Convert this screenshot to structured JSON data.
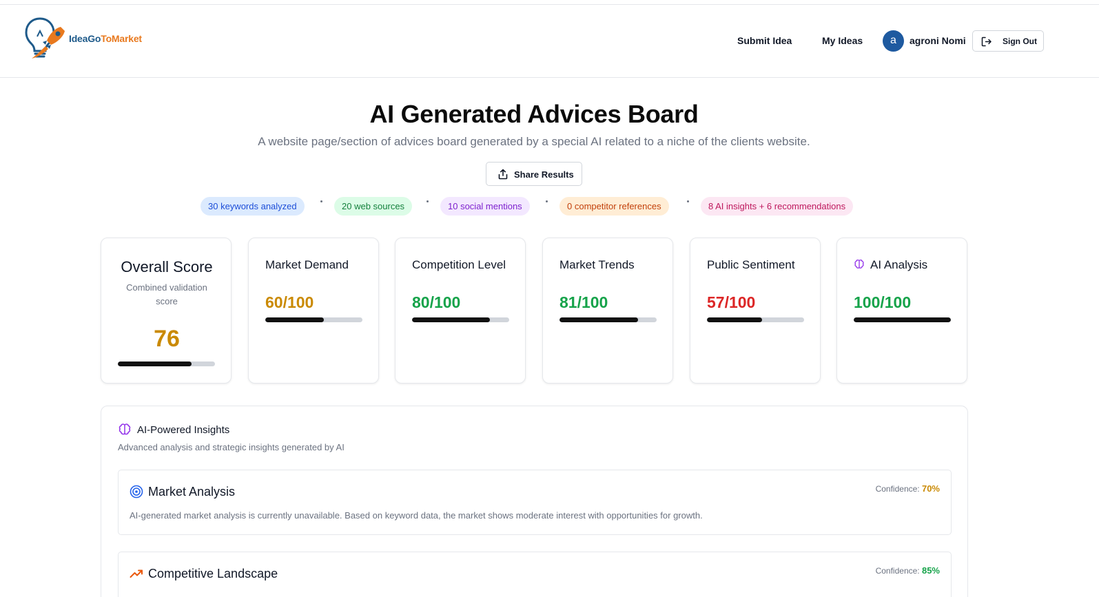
{
  "brand": {
    "name_part1": "IdeaGo",
    "name_part2": "ToMarket"
  },
  "nav": {
    "submit_idea": "Submit Idea",
    "my_ideas": "My Ideas",
    "avatar_initial": "a",
    "username": "agroni Nomi",
    "sign_out": "Sign Out"
  },
  "page": {
    "title": "AI Generated Advices Board",
    "subtitle": "A website page/section of advices board generated by a special AI related to a niche of the clients website.",
    "share_label": "Share Results"
  },
  "stats": [
    {
      "label": "30 keywords analyzed",
      "bg": "#dbeafe",
      "color": "#1d4ed8"
    },
    {
      "label": "20 web sources",
      "bg": "#dcfce7",
      "color": "#15803d"
    },
    {
      "label": "10 social mentions",
      "bg": "#f3e8ff",
      "color": "#7e22ce"
    },
    {
      "label": "0 competitor references",
      "bg": "#ffedd5",
      "color": "#c2410c"
    },
    {
      "label": "8 AI insights + 6 recommendations",
      "bg": "#fce7f3",
      "color": "#be185d"
    }
  ],
  "overall": {
    "title": "Overall Score",
    "description": "Combined validation score",
    "score": "76",
    "score_fraction": 0.76,
    "color": "#ca8a04"
  },
  "metrics": [
    {
      "name": "Market Demand",
      "score": "60/100",
      "fraction": 0.6,
      "color": "#ca8a04"
    },
    {
      "name": "Competition Level",
      "score": "80/100",
      "fraction": 0.8,
      "color": "#16a34a"
    },
    {
      "name": "Market Trends",
      "score": "81/100",
      "fraction": 0.81,
      "color": "#16a34a"
    },
    {
      "name": "Public Sentiment",
      "score": "57/100",
      "fraction": 0.57,
      "color": "#dc2626"
    },
    {
      "name": "AI Analysis",
      "score": "100/100",
      "fraction": 1.0,
      "color": "#16a34a",
      "icon": "brain-icon"
    }
  ],
  "insights": {
    "title": "AI-Powered Insights",
    "description": "Advanced analysis and strategic insights generated by AI",
    "items": [
      {
        "title": "Market Analysis",
        "icon": "target-icon",
        "confidence_label": "Confidence:",
        "confidence": "70%",
        "confidence_color": "#ca8a04",
        "text": "AI-generated market analysis is currently unavailable. Based on keyword data, the market shows moderate interest with opportunities for growth."
      },
      {
        "title": "Competitive Landscape",
        "icon": "trending-up-icon",
        "confidence_label": "Confidence:",
        "confidence": "85%",
        "confidence_color": "#16a34a",
        "text": ""
      }
    ]
  }
}
